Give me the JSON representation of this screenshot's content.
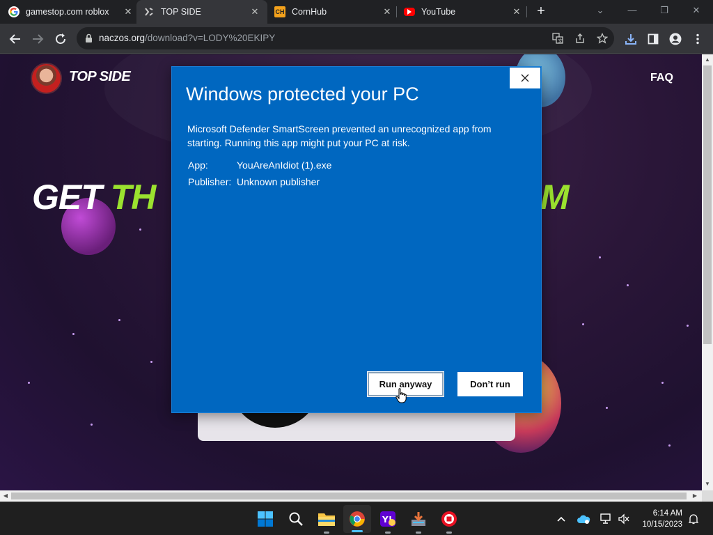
{
  "browser": {
    "tabs": [
      {
        "title": "gamestop.com roblox",
        "favicon": "google-icon",
        "active": false
      },
      {
        "title": "TOP SIDE",
        "favicon": "topside-icon",
        "active": true
      },
      {
        "title": "CornHub",
        "favicon": "cornhub-icon",
        "active": false
      },
      {
        "title": "YouTube",
        "favicon": "youtube-icon",
        "active": false
      }
    ],
    "url_host": "naczos.org",
    "url_path": "/download?v=LODY%20EKIPY"
  },
  "page": {
    "logo_text": "TOP SIDE",
    "nav_faq": "FAQ",
    "hero_left": "GET ",
    "hero_green": "TH",
    "hero_right": "M"
  },
  "dialog": {
    "title": "Windows protected your PC",
    "message": "Microsoft Defender SmartScreen prevented an unrecognized app from starting. Running this app might put your PC at risk.",
    "app_label": "App:",
    "app_value": "YouAreAnIdiot (1).exe",
    "publisher_label": "Publisher:",
    "publisher_value": "Unknown publisher",
    "run_button": "Run anyway",
    "dont_run_button": "Don’t run"
  },
  "taskbar": {
    "time": "6:14 AM",
    "date": "10/15/2023"
  },
  "colors": {
    "dialog_blue": "#0067c0",
    "hero_green": "#9be22f",
    "chrome_dark": "#202124"
  }
}
